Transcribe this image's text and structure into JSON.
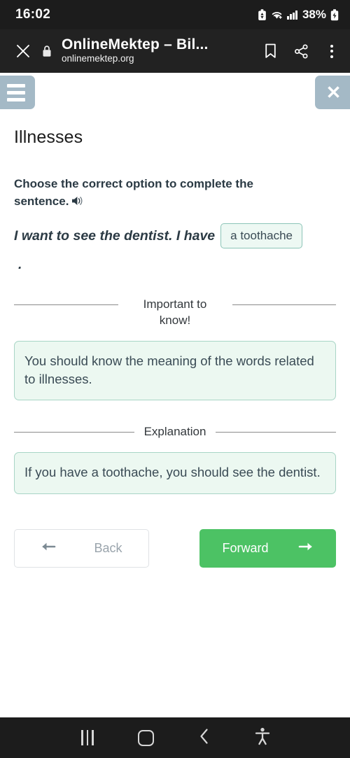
{
  "status_bar": {
    "time": "16:02",
    "battery_percent": "38%",
    "icons": [
      "battery-saver-icon",
      "wifi-icon",
      "signal-bars-icon",
      "charging-battery-icon"
    ]
  },
  "browser": {
    "close_icon": "close-icon",
    "lock_icon": "lock-icon",
    "title": "OnlineMektep – Bil...",
    "url": "onlinemektep.org",
    "actions": [
      "bookmark-icon",
      "share-icon",
      "overflow-menu-icon"
    ]
  },
  "page": {
    "menu_button_label": "menu-icon",
    "close_button_label": "✕",
    "title": "Illnesses",
    "prompt": "Choose the correct option to complete the sentence.",
    "speaker_icon": "speaker-icon",
    "sentence": "I want to see the dentist. I have",
    "answer": "a toothache",
    "sentence_end": ".",
    "sections": [
      {
        "label": "Important to know!",
        "body": "You should know the meaning of the words related to illnesses."
      },
      {
        "label": "Explanation",
        "body": "If you have a toothache, you should see the dentist."
      }
    ],
    "back_label": "Back",
    "forward_label": "Forward",
    "back_arrow": "←",
    "forward_arrow": "→"
  },
  "nav_bar": {
    "recents_label": "recents-icon",
    "home_label": "home-icon",
    "back_label": "back-icon",
    "accessibility_label": "accessibility-icon"
  },
  "colors": {
    "accent_green": "#4cc264",
    "chip_border": "#8cc4b7",
    "chip_fill": "#edf8f3",
    "header_button": "#a4b9c6",
    "chrome_bg": "#222222"
  }
}
